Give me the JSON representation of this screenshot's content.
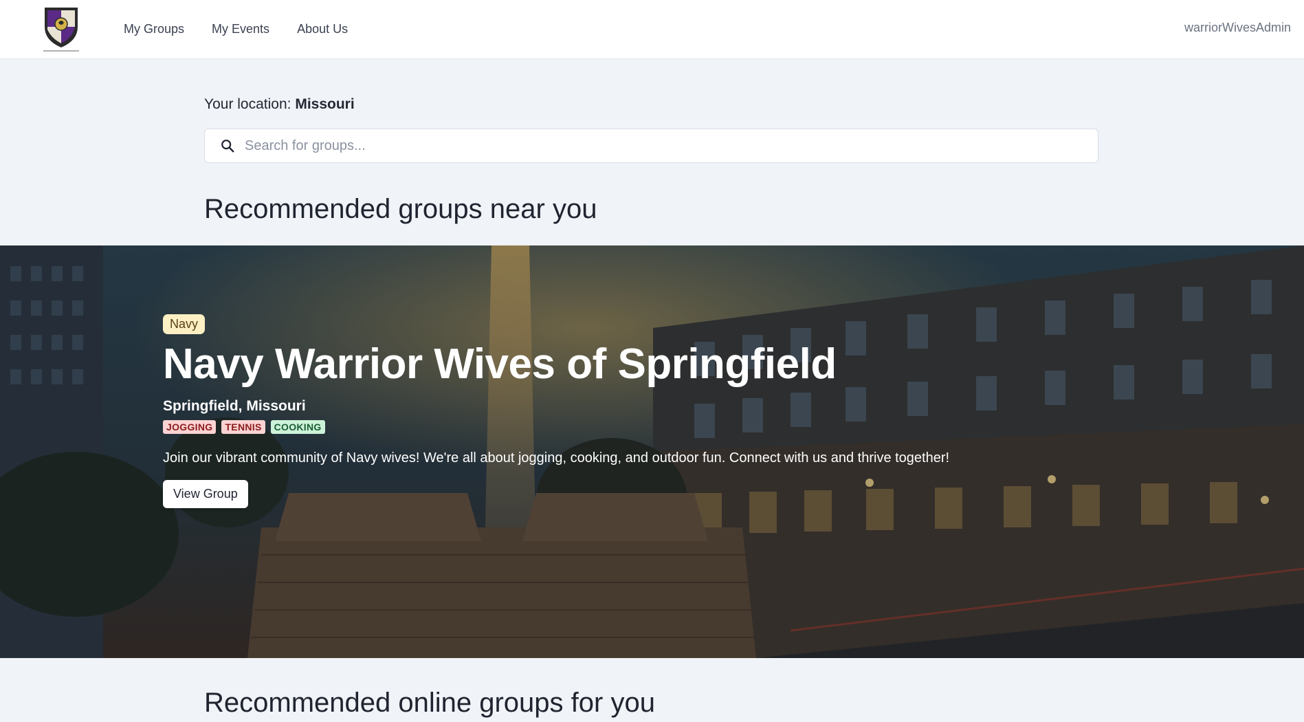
{
  "header": {
    "nav": [
      "My Groups",
      "My Events",
      "About Us"
    ],
    "user": "warriorWivesAdmin"
  },
  "location": {
    "label": "Your location:",
    "value": "Missouri"
  },
  "search": {
    "placeholder": "Search for groups...",
    "icon": "search-icon"
  },
  "sections": {
    "near": "Recommended groups near you",
    "online": "Recommended online groups for you"
  },
  "featured_group": {
    "branch": "Navy",
    "title": "Navy Warrior Wives of Springfield",
    "location": "Springfield, Missouri",
    "tags": [
      "JOGGING",
      "TENNIS",
      "COOKING"
    ],
    "description": "Join our vibrant community of Navy wives! We're all about jogging, cooking, and outdoor fun. Connect with us and thrive together!",
    "button": "View Group"
  },
  "colors": {
    "accent_purple": "#5b2a86",
    "branch_badge": "#fdf0c4",
    "tag_pink": "#fcd3d3",
    "tag_green": "#cdf2d9",
    "page_background": "#f0f3f7"
  }
}
